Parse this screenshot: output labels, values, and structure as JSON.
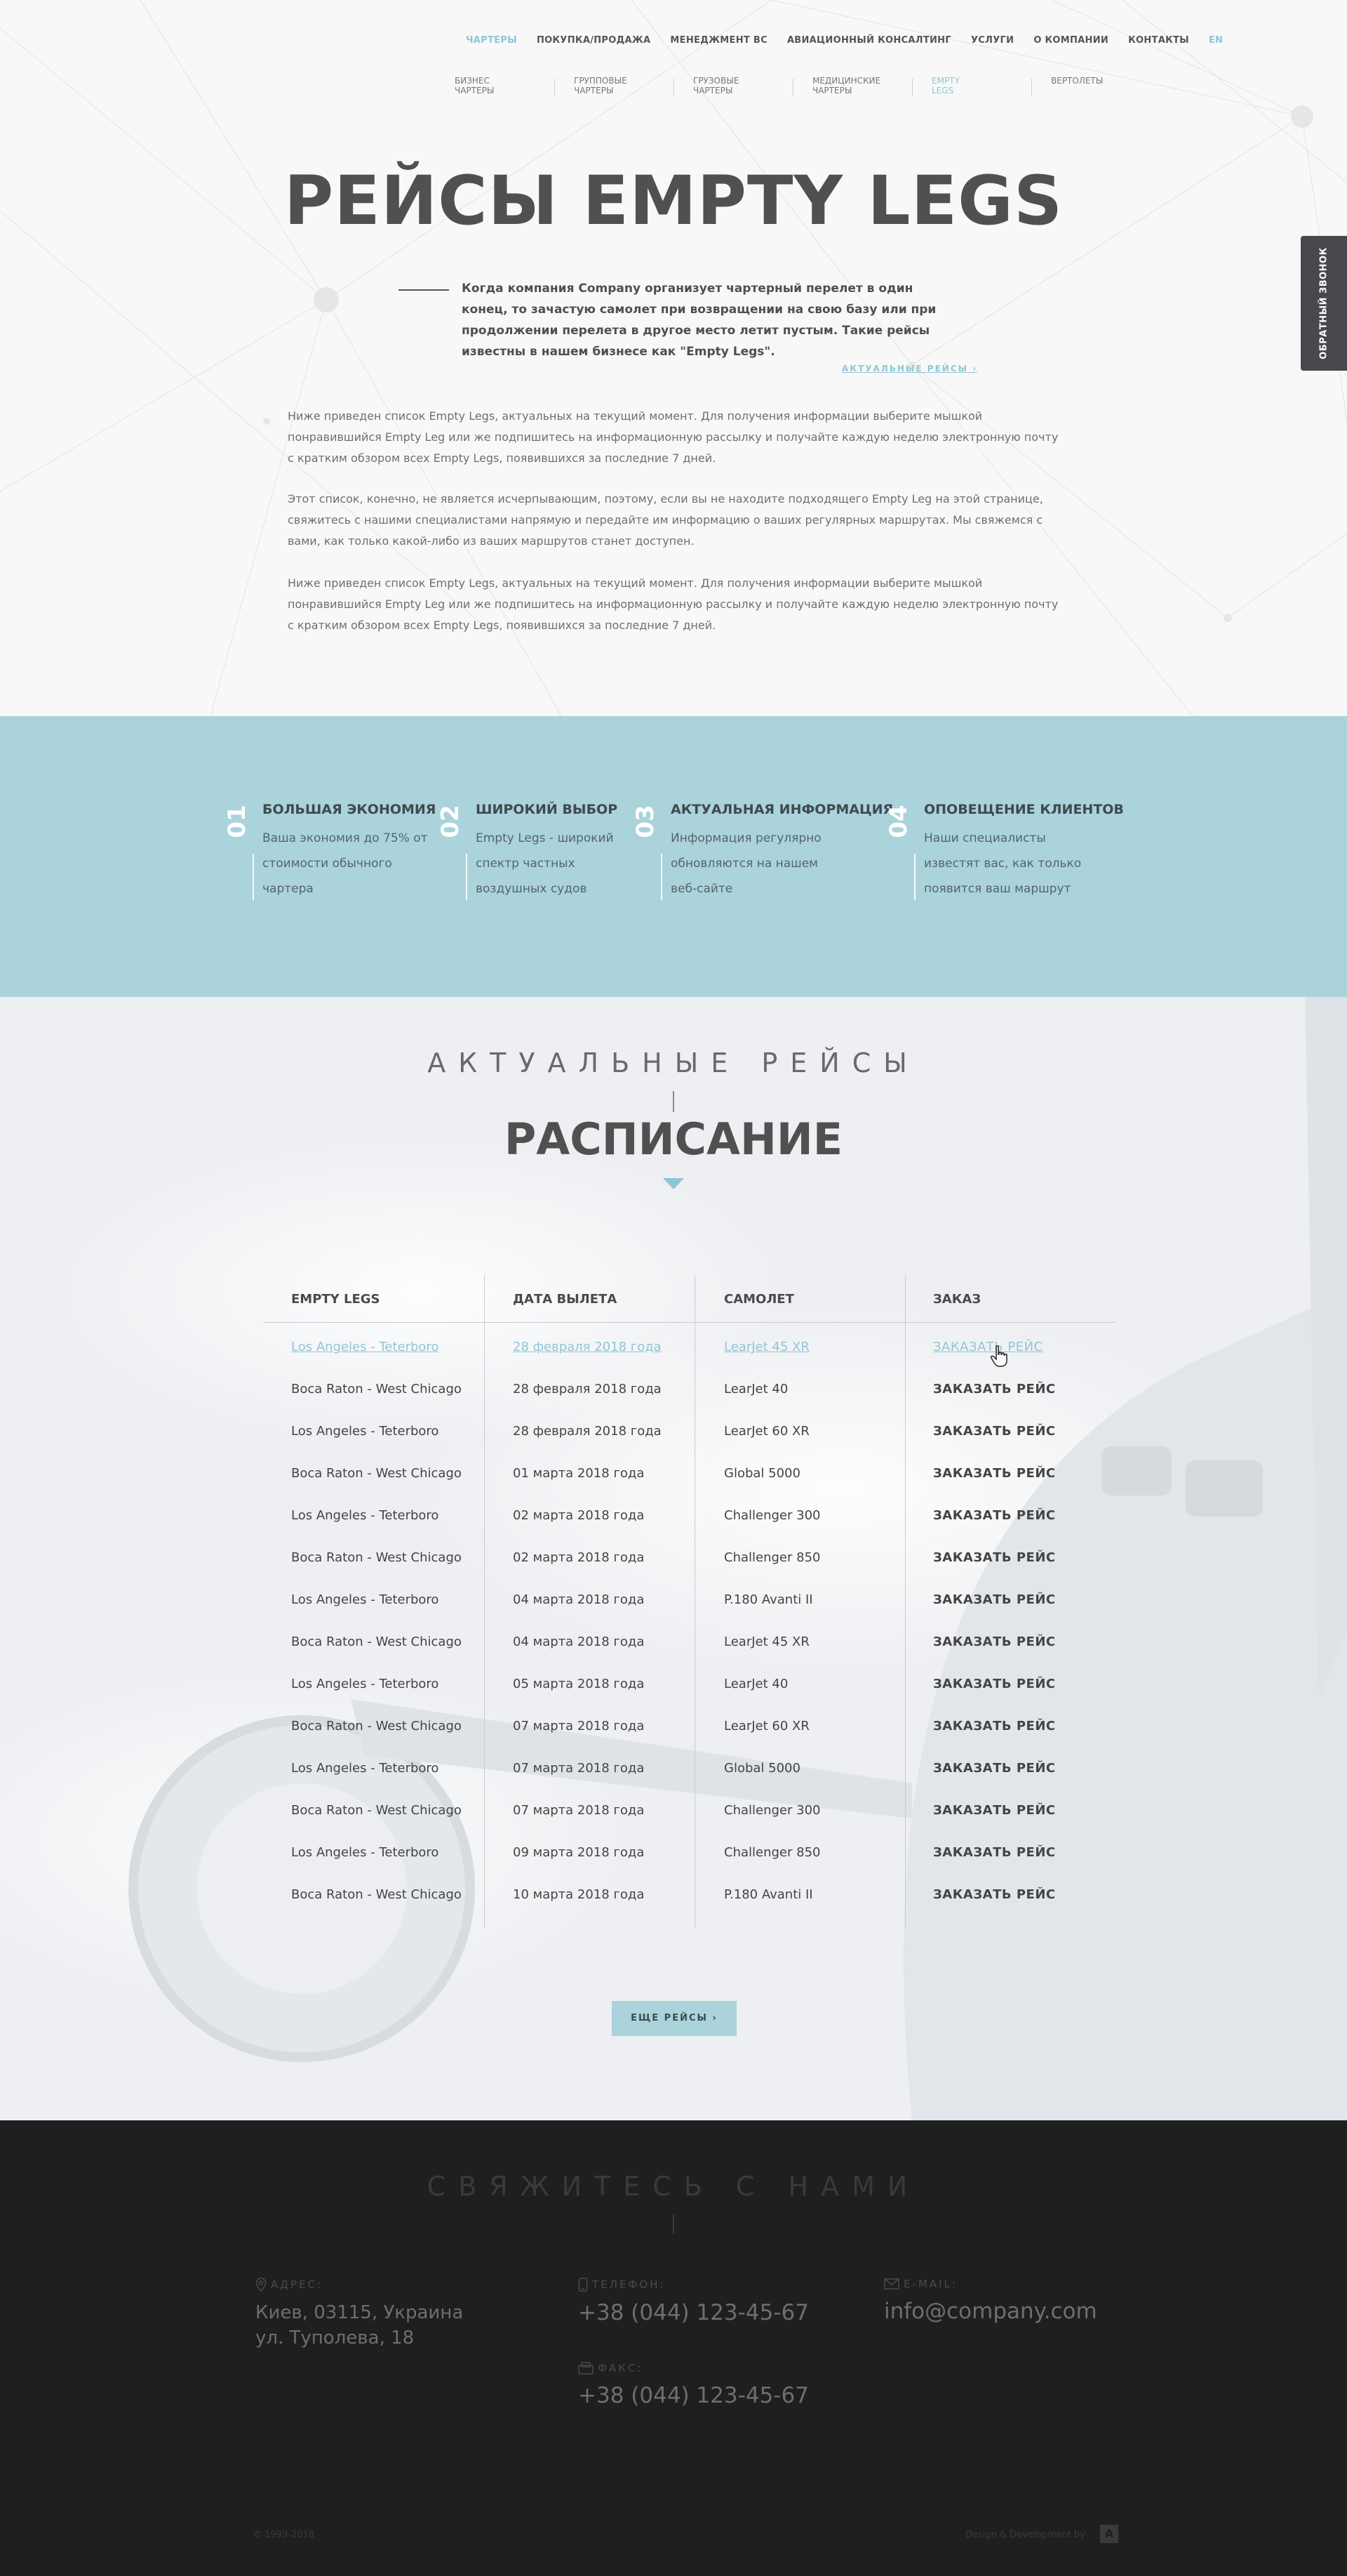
{
  "nav": {
    "items": [
      {
        "label": "ЧАРТЕРЫ",
        "active": true
      },
      {
        "label": "ПОКУПКА/ПРОДАЖА",
        "active": false
      },
      {
        "label": "МЕНЕДЖМЕНТ ВС",
        "active": false
      },
      {
        "label": "АВИАЦИОННЫЙ КОНСАЛТИНГ",
        "active": false
      },
      {
        "label": "УСЛУГИ",
        "active": false
      },
      {
        "label": "О КОМПАНИИ",
        "active": false
      },
      {
        "label": "КОНТАКТЫ",
        "active": false
      },
      {
        "label": "EN",
        "active": true
      }
    ],
    "sub": [
      {
        "label": "БИЗНЕС\nЧАРТЕРЫ",
        "active": false
      },
      {
        "label": "ГРУППОВЫЕ\nЧАРТЕРЫ",
        "active": false
      },
      {
        "label": "ГРУЗОВЫЕ\nЧАРТЕРЫ",
        "active": false
      },
      {
        "label": "МЕДИЦИНСКИЕ\nЧАРТЕРЫ",
        "active": false
      },
      {
        "label": "EMPTY\nLEGS",
        "active": true
      },
      {
        "label": "ВЕРТОЛЕТЫ",
        "active": false
      }
    ]
  },
  "callback": {
    "label": "ОБРАТНЫЙ ЗВОНОК"
  },
  "hero": {
    "title": "РЕЙСЫ EMPTY LEGS",
    "lead": "Когда компания Company организует чартерный перелет в один конец, то зачастую самолет при возвращении на свою базу или при продолжении перелета в другое место летит пустым. Такие рейсы известны в нашем бизнесе как \"Empty Legs\".",
    "lead_link": "АКТУАЛЬНЫЕ РЕЙСЫ ›",
    "paragraphs": [
      "Ниже приведен список Empty Legs, актуальных на текущий момент. Для получения информации выберите мышкой понравившийся Empty Leg или же подпишитесь на информационную рассылку и получайте каждую неделю электронную почту с кратким обзором всех Empty Legs, появившихся за последние 7 дней.",
      "Этот список, конечно, не является исчерпывающим, поэтому, если вы не находите подходящего Empty Leg на этой странице, свяжитесь с нашими специалистами напрямую и передайте им информацию о ваших регулярных маршрутах. Мы свяжемся с вами, как только какой-либо из ваших маршрутов станет доступен.",
      "Ниже приведен список Empty Legs, актуальных на текущий момент. Для получения информации выберите мышкой понравившийся Empty Leg или же подпишитесь на информационную рассылку и получайте каждую неделю электронную почту с кратким обзором всех Empty Legs, появившихся за последние 7 дней."
    ]
  },
  "features": [
    {
      "num": "01",
      "title": "БОЛЬШАЯ ЭКОНОМИЯ",
      "text": "Ваша экономия до 75% от стоимости обычного чартера"
    },
    {
      "num": "02",
      "title": "ШИРОКИЙ ВЫБОР",
      "text": "Empty Legs - широкий спектр частных воздушных судов"
    },
    {
      "num": "03",
      "title": "АКТУАЛЬНАЯ ИНФОРМАЦИЯ",
      "text": "Информация регулярно обновляются на нашем веб-сайте"
    },
    {
      "num": "04",
      "title": "ОПОВЕЩЕНИЕ КЛИЕНТОВ",
      "text": "Наши специалисты известят вас, как только появится  ваш маршрут"
    }
  ],
  "schedule": {
    "subtitle": "АКТУАЛЬНЫЕ РЕЙСЫ",
    "title": "РАСПИСАНИЕ",
    "columns": [
      "EMPTY LEGS",
      "ДАТА ВЫЛЕТА",
      "САМОЛЕТ",
      "ЗАКАЗ"
    ],
    "rows": [
      {
        "route": "Los Angeles - Teterboro",
        "date": "28 февраля 2018 года",
        "plane": "LearJet 45 XR",
        "order": "ЗАКАЗАТЬ РЕЙС"
      },
      {
        "route": "Boca Raton - West Chicago",
        "date": "28 февраля 2018 года",
        "plane": "LearJet 40",
        "order": "ЗАКАЗАТЬ РЕЙС"
      },
      {
        "route": "Los Angeles - Teterboro",
        "date": "28 февраля 2018 года",
        "plane": "LearJet 60 XR",
        "order": "ЗАКАЗАТЬ РЕЙС"
      },
      {
        "route": "Boca Raton - West Chicago",
        "date": "01 марта 2018 года",
        "plane": "Global 5000",
        "order": "ЗАКАЗАТЬ РЕЙС"
      },
      {
        "route": "Los Angeles - Teterboro",
        "date": "02 марта 2018 года",
        "plane": "Challenger 300",
        "order": "ЗАКАЗАТЬ РЕЙС"
      },
      {
        "route": "Boca Raton - West Chicago",
        "date": "02 марта 2018 года",
        "plane": "Challenger 850",
        "order": "ЗАКАЗАТЬ РЕЙС"
      },
      {
        "route": "Los Angeles - Teterboro",
        "date": "04 марта 2018 года",
        "plane": "P.180 Avanti II",
        "order": "ЗАКАЗАТЬ РЕЙС"
      },
      {
        "route": "Boca Raton - West Chicago",
        "date": "04 марта 2018 года",
        "plane": "LearJet 45 XR",
        "order": "ЗАКАЗАТЬ РЕЙС"
      },
      {
        "route": "Los Angeles - Teterboro",
        "date": "05 марта 2018 года",
        "plane": "LearJet 40",
        "order": "ЗАКАЗАТЬ РЕЙС"
      },
      {
        "route": "Boca Raton - West Chicago",
        "date": "07 марта 2018 года",
        "plane": "LearJet 60 XR",
        "order": "ЗАКАЗАТЬ РЕЙС"
      },
      {
        "route": "Los Angeles - Teterboro",
        "date": "07 марта 2018 года",
        "plane": "Global 5000",
        "order": "ЗАКАЗАТЬ РЕЙС"
      },
      {
        "route": "Boca Raton - West Chicago",
        "date": "07 марта 2018 года",
        "plane": "Challenger 300",
        "order": "ЗАКАЗАТЬ РЕЙС"
      },
      {
        "route": "Los Angeles - Teterboro",
        "date": "09 марта 2018 года",
        "plane": "Challenger 850",
        "order": "ЗАКАЗАТЬ РЕЙС"
      },
      {
        "route": "Boca Raton - West Chicago",
        "date": "10 марта 2018 года",
        "plane": "P.180 Avanti II",
        "order": "ЗАКАЗАТЬ РЕЙС"
      }
    ],
    "more_button": "ЕЩЕ РЕЙСЫ   ›"
  },
  "contacts": {
    "title": "СВЯЖИТЕСЬ С НАМИ",
    "address_label": "АДРЕС:",
    "address": "Киев, 03115, Украина\nул. Туполева, 18",
    "phone_label": "ТЕЛЕФОН:",
    "phone": "+38 (044) 123-45-67",
    "fax_label": "ФАКС:",
    "fax": "+38 (044) 123-45-67",
    "email_label": "E-MAIL:",
    "email": "info@company.com",
    "copyright": "© 1999-2018",
    "design": "Design & Development by",
    "design_logo": "A"
  },
  "colors": {
    "accent": "#8fc6d6",
    "features_bg": "#aad3dc",
    "footer_bg": "#1f1f20"
  }
}
